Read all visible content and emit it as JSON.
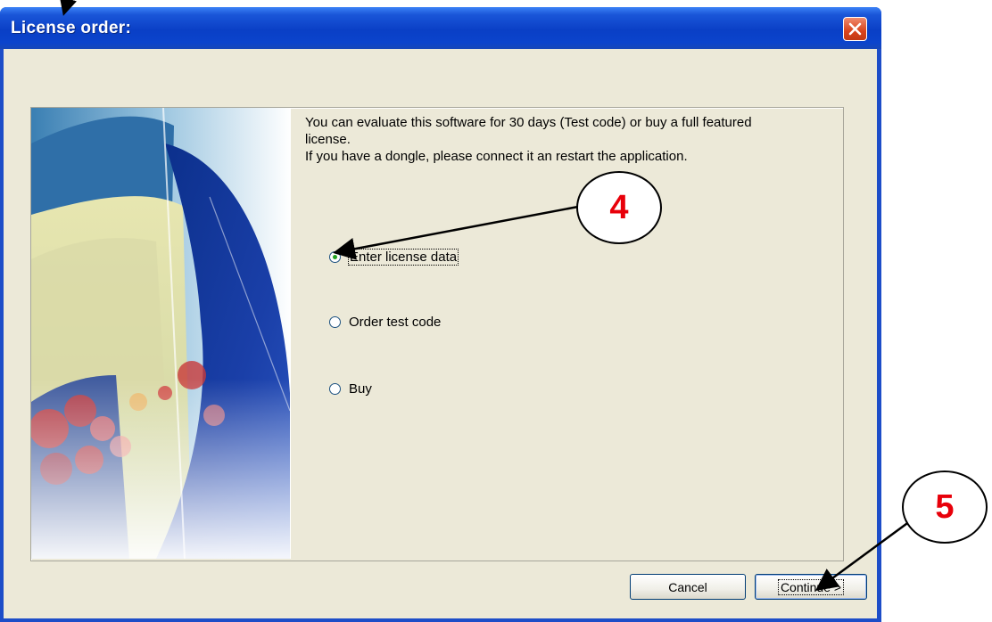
{
  "window": {
    "title": "License order:",
    "close_icon": "close-x-icon"
  },
  "dialog": {
    "description_lines": [
      "You can evaluate this software for 30 days (Test code) or buy a full featured",
      "license.",
      "If you have a dongle, please connect it an restart the application."
    ],
    "options": [
      {
        "label": "Enter license data",
        "selected": true
      },
      {
        "label": "Order test code",
        "selected": false
      },
      {
        "label": "Buy",
        "selected": false
      }
    ],
    "buttons": {
      "cancel_label": "Cancel",
      "continue_label": "Continue >"
    }
  },
  "callouts": {
    "step_4": "4",
    "step_5": "5"
  },
  "colors": {
    "titlebar": "#0a3fc6",
    "dialog_bg": "#ece9d8",
    "callout_text": "#e8000a",
    "radio_dot": "#21a121"
  }
}
